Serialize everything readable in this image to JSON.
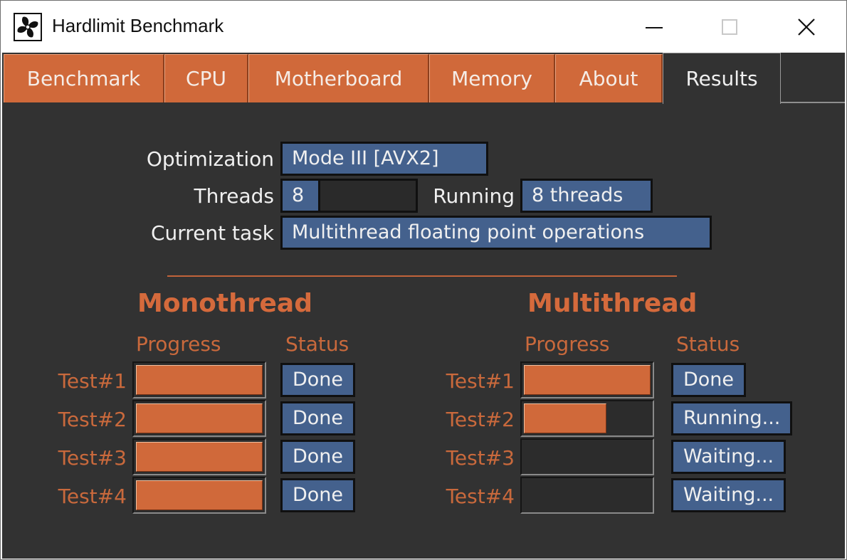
{
  "window": {
    "title": "Hardlimit Benchmark"
  },
  "tabs": [
    {
      "label": "Benchmark"
    },
    {
      "label": "CPU"
    },
    {
      "label": "Motherboard"
    },
    {
      "label": "Memory"
    },
    {
      "label": "About"
    },
    {
      "label": "Results",
      "active": true
    }
  ],
  "info": {
    "optimization_label": "Optimization",
    "optimization_value": "Mode III [AVX2]",
    "threads_label": "Threads",
    "threads_value": "8",
    "running_label": "Running",
    "running_value": "8 threads",
    "task_label": "Current task",
    "task_value": "Multithread floating point operations"
  },
  "mono": {
    "title": "Monothread",
    "progress_header": "Progress",
    "status_header": "Status",
    "tests": [
      {
        "label": "Test#1",
        "progress": 1.0,
        "status": "Done"
      },
      {
        "label": "Test#2",
        "progress": 1.0,
        "status": "Done"
      },
      {
        "label": "Test#3",
        "progress": 1.0,
        "status": "Done"
      },
      {
        "label": "Test#4",
        "progress": 1.0,
        "status": "Done"
      }
    ]
  },
  "multi": {
    "title": "Multithread",
    "progress_header": "Progress",
    "status_header": "Status",
    "tests": [
      {
        "label": "Test#1",
        "progress": 1.0,
        "status": "Done"
      },
      {
        "label": "Test#2",
        "progress": 0.65,
        "status": "Running..."
      },
      {
        "label": "Test#3",
        "progress": 0,
        "status": "Waiting..."
      },
      {
        "label": "Test#4",
        "progress": 0,
        "status": "Waiting..."
      }
    ]
  },
  "icons": {
    "app": "fan-icon",
    "minimize": "minimize-icon",
    "maximize": "maximize-icon",
    "close": "close-icon"
  },
  "colors": {
    "accent": "#d0693a",
    "value_box": "#44618d",
    "background": "#323232"
  }
}
